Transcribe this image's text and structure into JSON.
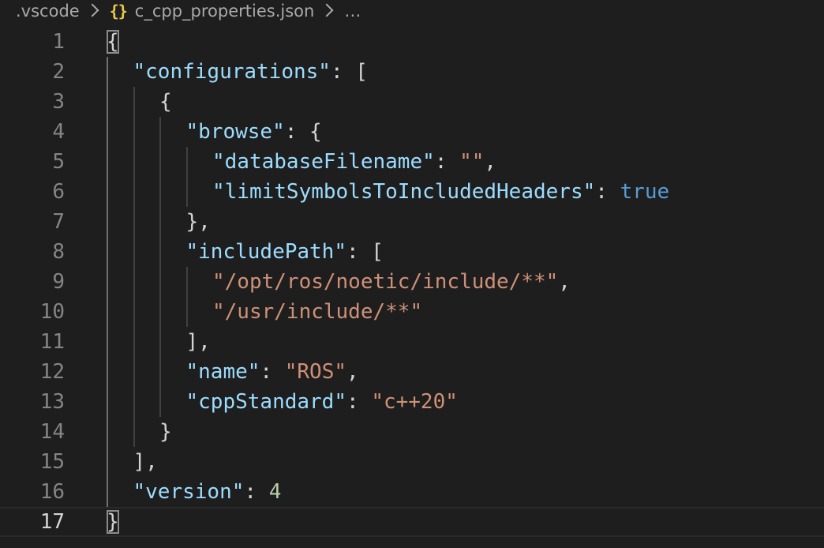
{
  "breadcrumb": {
    "folder": ".vscode",
    "file_icon": "{}",
    "file": "c_cpp_properties.json",
    "more": "…"
  },
  "editor": {
    "current_line": 17,
    "lines": [
      {
        "num": "1",
        "indent": 0,
        "tokens": [
          {
            "t": "p",
            "v": "{"
          }
        ]
      },
      {
        "num": "2",
        "indent": 1,
        "tokens": [
          {
            "t": "k",
            "v": "\"configurations\""
          },
          {
            "t": "p",
            "v": ": ["
          }
        ]
      },
      {
        "num": "3",
        "indent": 2,
        "tokens": [
          {
            "t": "p",
            "v": "{"
          }
        ]
      },
      {
        "num": "4",
        "indent": 3,
        "tokens": [
          {
            "t": "k",
            "v": "\"browse\""
          },
          {
            "t": "p",
            "v": ": {"
          }
        ]
      },
      {
        "num": "5",
        "indent": 4,
        "tokens": [
          {
            "t": "k",
            "v": "\"databaseFilename\""
          },
          {
            "t": "p",
            "v": ": "
          },
          {
            "t": "s",
            "v": "\"\""
          },
          {
            "t": "p",
            "v": ","
          }
        ]
      },
      {
        "num": "6",
        "indent": 4,
        "tokens": [
          {
            "t": "k",
            "v": "\"limitSymbolsToIncludedHeaders\""
          },
          {
            "t": "p",
            "v": ": "
          },
          {
            "t": "b",
            "v": "true"
          }
        ]
      },
      {
        "num": "7",
        "indent": 3,
        "tokens": [
          {
            "t": "p",
            "v": "},"
          }
        ]
      },
      {
        "num": "8",
        "indent": 3,
        "tokens": [
          {
            "t": "k",
            "v": "\"includePath\""
          },
          {
            "t": "p",
            "v": ": ["
          }
        ]
      },
      {
        "num": "9",
        "indent": 4,
        "tokens": [
          {
            "t": "s",
            "v": "\"/opt/ros/noetic/include/**\""
          },
          {
            "t": "p",
            "v": ","
          }
        ]
      },
      {
        "num": "10",
        "indent": 4,
        "tokens": [
          {
            "t": "s",
            "v": "\"/usr/include/**\""
          }
        ]
      },
      {
        "num": "11",
        "indent": 3,
        "tokens": [
          {
            "t": "p",
            "v": "],"
          }
        ]
      },
      {
        "num": "12",
        "indent": 3,
        "tokens": [
          {
            "t": "k",
            "v": "\"name\""
          },
          {
            "t": "p",
            "v": ": "
          },
          {
            "t": "s",
            "v": "\"ROS\""
          },
          {
            "t": "p",
            "v": ","
          }
        ]
      },
      {
        "num": "13",
        "indent": 3,
        "tokens": [
          {
            "t": "k",
            "v": "\"cppStandard\""
          },
          {
            "t": "p",
            "v": ": "
          },
          {
            "t": "s",
            "v": "\"c++20\""
          }
        ]
      },
      {
        "num": "14",
        "indent": 2,
        "tokens": [
          {
            "t": "p",
            "v": "}"
          }
        ]
      },
      {
        "num": "15",
        "indent": 1,
        "tokens": [
          {
            "t": "p",
            "v": "],"
          }
        ]
      },
      {
        "num": "16",
        "indent": 1,
        "tokens": [
          {
            "t": "k",
            "v": "\"version\""
          },
          {
            "t": "p",
            "v": ": "
          },
          {
            "t": "n",
            "v": "4"
          }
        ]
      },
      {
        "num": "17",
        "indent": 0,
        "tokens": [
          {
            "t": "p",
            "v": "}"
          }
        ]
      }
    ]
  },
  "colors": {
    "background": "#1e1e1e",
    "key": "#9cdcfe",
    "string": "#ce9178",
    "number": "#b5cea8",
    "boolean": "#569cd6",
    "punctuation": "#d4d4d4",
    "line_number": "#858585",
    "json_icon": "#e8c94b"
  }
}
